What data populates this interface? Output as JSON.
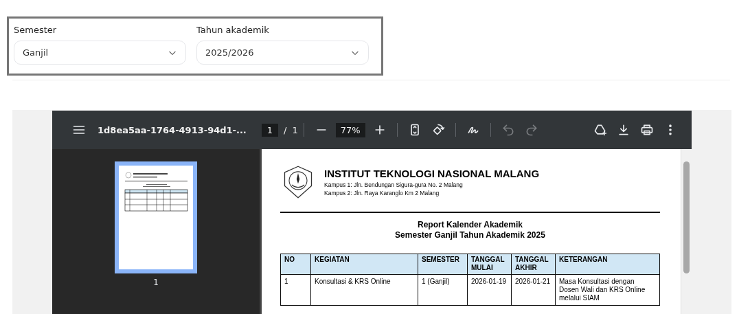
{
  "filters": [
    {
      "label": "Semester",
      "value": "Ganjil"
    },
    {
      "label": "Tahun akademik",
      "value": "2025/2026"
    }
  ],
  "viewer": {
    "file_name": "1d8ea5aa-1764-4913-94d1-...",
    "page_current": "1",
    "page_separator": "/",
    "page_total": "1",
    "zoom": "77%",
    "undo": {
      "disabled": true
    },
    "redo": {
      "disabled": true
    },
    "thumbnails": [
      {
        "label": "1",
        "selected": true
      }
    ],
    "document": {
      "institution": "INSTITUT TEKNOLOGI NASIONAL MALANG",
      "addresses": [
        "Kampus 1: Jln. Bendungan Sigura-gura No. 2 Malang",
        "Kampus 2: Jln. Raya Karanglo Km 2 Malang"
      ],
      "report_title": [
        "Report Kalender Akademik",
        "Semester Ganjil Tahun Akademik 2025"
      ],
      "table": {
        "columns": [
          "NO",
          "KEGIATAN",
          "SEMESTER",
          "TANGGAL MULAI",
          "TANGGAL AKHIR",
          "KETERANGAN"
        ],
        "rows": [
          [
            "1",
            "Konsultasi & KRS Online",
            "1 (Ganjil)",
            "2026-01-19",
            "2026-01-21",
            "Masa Konsultasi dengan Dosen Wali dan KRS Online melalui SIAM"
          ]
        ]
      }
    }
  }
}
